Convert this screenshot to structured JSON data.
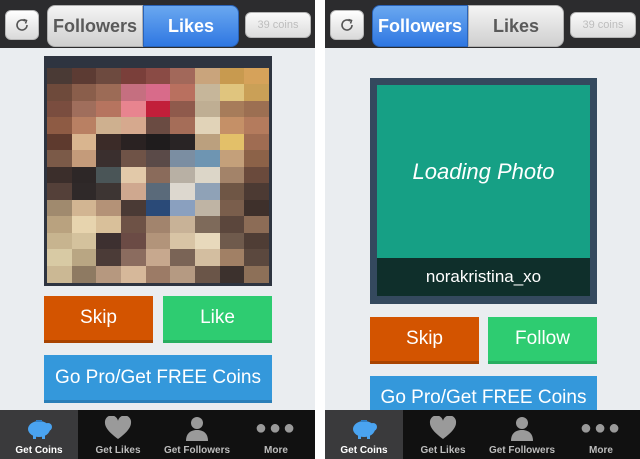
{
  "left_screen": {
    "header": {
      "tab_followers": "Followers",
      "tab_likes": "Likes",
      "active_tab": "likes",
      "coins": "39 coins"
    },
    "photo": {
      "mosaic_colors": [
        [
          "#4a3a35",
          "#5c3b33",
          "#6d4a3f",
          "#7a3f3a",
          "#8a4b45",
          "#a2685a",
          "#c9a47c",
          "#c89a4f",
          "#d6a25a"
        ],
        [
          "#6e4a3b",
          "#8a5e4b",
          "#9c6b56",
          "#c56f80",
          "#d86b8a",
          "#b9705f",
          "#c6b69a",
          "#e0c57e",
          "#caa057"
        ],
        [
          "#7a4d3f",
          "#a06e5c",
          "#b6745f",
          "#e8848f",
          "#c21f3a",
          "#8f5a4c",
          "#bfae93",
          "#a77c5a",
          "#9c6f52"
        ],
        [
          "#8e5b44",
          "#b98063",
          "#ceb08f",
          "#d6a98e",
          "#6a4b42",
          "#a56d58",
          "#e1d3b8",
          "#c59067",
          "#b47b5d"
        ],
        [
          "#5e3a2e",
          "#d9b58f",
          "#3b2b28",
          "#2a2222",
          "#1f1c1d",
          "#292425",
          "#bba07e",
          "#e3c069",
          "#9f6c52"
        ],
        [
          "#7b5a48",
          "#c49b7a",
          "#3a2f2e",
          "#6f5347",
          "#5a4a48",
          "#7b8ea2",
          "#6e95b2",
          "#c4a07a",
          "#8c6248"
        ],
        [
          "#3b2e2b",
          "#2d2727",
          "#4a5557",
          "#e2c9a9",
          "#8a6b5b",
          "#b8b0a4",
          "#dcd6c8",
          "#a38369",
          "#6a4a3c"
        ],
        [
          "#544039",
          "#2f2929",
          "#3d3533",
          "#cfa88f",
          "#5a6a7a",
          "#ddd8cf",
          "#8fa2b7",
          "#6f5645",
          "#4c3a33"
        ],
        [
          "#a08a6e",
          "#d2b592",
          "#b49277",
          "#4a3a35",
          "#2a4a78",
          "#8aa0bf",
          "#bfb4a4",
          "#7a5e4c",
          "#3e302b"
        ],
        [
          "#b9a27f",
          "#e7d4ae",
          "#d9c09a",
          "#6e5246",
          "#a2846d",
          "#c8b297",
          "#7e6a5a",
          "#5b463c",
          "#8c6c56"
        ],
        [
          "#c7b48f",
          "#d4c29d",
          "#3d3030",
          "#6b4b45",
          "#b2947a",
          "#d8c4a5",
          "#e8d9bc",
          "#6f5a4c",
          "#4f3d35"
        ],
        [
          "#d8caa4",
          "#b9a683",
          "#4b3b37",
          "#8b6c5f",
          "#c7a88e",
          "#7a6456",
          "#d3bea0",
          "#a18065",
          "#5b483e"
        ],
        [
          "#cbb894",
          "#8e7a62",
          "#b6987f",
          "#d6b89a",
          "#9c7b66",
          "#b59a82",
          "#6a5548",
          "#3c312d",
          "#8d7058"
        ]
      ]
    },
    "buttons": {
      "skip": "Skip",
      "like": "Like",
      "pro": "Go Pro/Get FREE Coins"
    },
    "tabbar": {
      "active": "get_coins",
      "items": [
        {
          "label": "Get Coins",
          "icon": "piggy-bank-icon"
        },
        {
          "label": "Get Likes",
          "icon": "heart-icon"
        },
        {
          "label": "Get Followers",
          "icon": "person-icon"
        },
        {
          "label": "More",
          "icon": "more-dots-icon"
        }
      ]
    }
  },
  "right_screen": {
    "header": {
      "tab_followers": "Followers",
      "tab_likes": "Likes",
      "active_tab": "followers",
      "coins": "39 coins"
    },
    "photo": {
      "loading_text": "Loading Photo",
      "username": "norakristina_xo"
    },
    "buttons": {
      "skip": "Skip",
      "follow": "Follow",
      "pro": "Go Pro/Get FREE Coins"
    },
    "tabbar": {
      "active": "get_coins",
      "items": [
        {
          "label": "Get Coins",
          "icon": "piggy-bank-icon"
        },
        {
          "label": "Get Likes",
          "icon": "heart-icon"
        },
        {
          "label": "Get Followers",
          "icon": "person-icon"
        },
        {
          "label": "More",
          "icon": "more-dots-icon"
        }
      ]
    }
  },
  "colors": {
    "active_segment": "#2f77e2",
    "skip": "#d35400",
    "like_follow": "#2ecc71",
    "pro": "#3498db",
    "loading_area": "#16a085"
  }
}
